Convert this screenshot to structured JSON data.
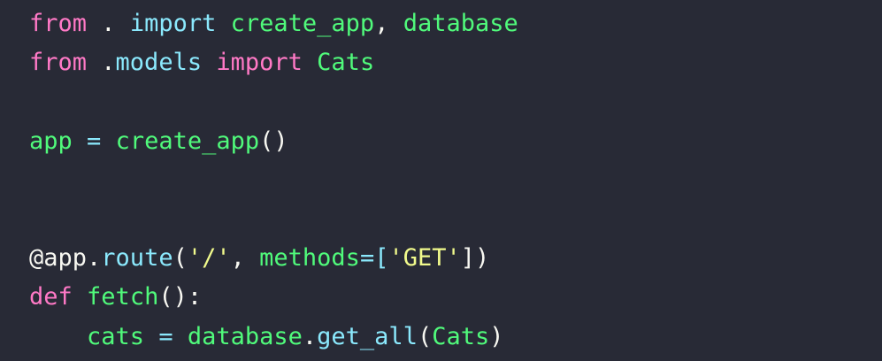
{
  "editor": {
    "theme_colors": {
      "background": "#282a36",
      "foreground": "#f8f8f2",
      "keyword": "#ff79c6",
      "function": "#50fa7b",
      "operator": "#8be9fd",
      "string": "#f1fa8c"
    },
    "lines": [
      {
        "tokens": [
          {
            "t": "from",
            "c": "kw"
          },
          {
            "t": " . ",
            "c": "pun"
          },
          {
            "t": "import",
            "c": "mod"
          },
          {
            "t": " ",
            "c": "pun"
          },
          {
            "t": "create_app",
            "c": "fn"
          },
          {
            "t": ", ",
            "c": "pun"
          },
          {
            "t": "database",
            "c": "fn"
          }
        ]
      },
      {
        "tokens": [
          {
            "t": "from",
            "c": "kw"
          },
          {
            "t": " .",
            "c": "pun"
          },
          {
            "t": "models",
            "c": "mod"
          },
          {
            "t": " ",
            "c": "pun"
          },
          {
            "t": "import",
            "c": "kw"
          },
          {
            "t": " ",
            "c": "pun"
          },
          {
            "t": "Cats",
            "c": "fn"
          }
        ]
      },
      {
        "tokens": []
      },
      {
        "tokens": [
          {
            "t": "app",
            "c": "fn"
          },
          {
            "t": " = ",
            "c": "op"
          },
          {
            "t": "create_app",
            "c": "fn"
          },
          {
            "t": "()",
            "c": "pun"
          }
        ]
      },
      {
        "tokens": []
      },
      {
        "tokens": []
      },
      {
        "tokens": [
          {
            "t": "@app",
            "c": "dec"
          },
          {
            "t": ".",
            "c": "pun"
          },
          {
            "t": "route",
            "c": "mth"
          },
          {
            "t": "(",
            "c": "pun"
          },
          {
            "t": "'/'",
            "c": "str"
          },
          {
            "t": ", ",
            "c": "pun"
          },
          {
            "t": "methods",
            "c": "fn"
          },
          {
            "t": "=[",
            "c": "op"
          },
          {
            "t": "'GET'",
            "c": "str"
          },
          {
            "t": "])",
            "c": "pun"
          }
        ]
      },
      {
        "tokens": [
          {
            "t": "def",
            "c": "kw"
          },
          {
            "t": " ",
            "c": "pun"
          },
          {
            "t": "fetch",
            "c": "fn"
          },
          {
            "t": "():",
            "c": "pun"
          }
        ]
      },
      {
        "tokens": [
          {
            "t": "    ",
            "c": "pun"
          },
          {
            "t": "cats",
            "c": "fn"
          },
          {
            "t": " = ",
            "c": "op"
          },
          {
            "t": "database",
            "c": "fn"
          },
          {
            "t": ".",
            "c": "pun"
          },
          {
            "t": "get_all",
            "c": "mth"
          },
          {
            "t": "(",
            "c": "pun"
          },
          {
            "t": "Cats",
            "c": "fn"
          },
          {
            "t": ")",
            "c": "pun"
          }
        ]
      }
    ]
  }
}
